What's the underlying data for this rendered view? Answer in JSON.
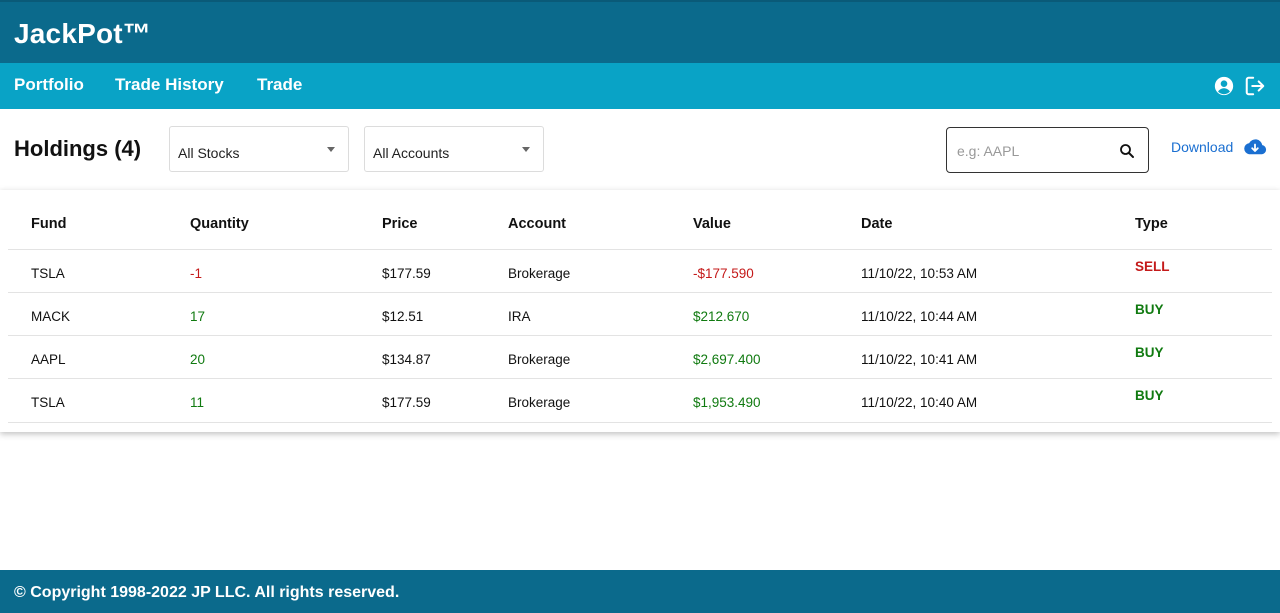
{
  "app": {
    "brand": "JackPot™"
  },
  "nav": {
    "items": [
      {
        "label": "Portfolio"
      },
      {
        "label": "Trade History"
      },
      {
        "label": "Trade"
      }
    ],
    "icons": [
      "user-circle-icon",
      "logout-icon"
    ]
  },
  "toolbar": {
    "title": "Holdings (4)",
    "stocks_filter": {
      "selected": "All Stocks"
    },
    "accounts_filter": {
      "selected": "All Accounts"
    },
    "search": {
      "placeholder": "e.g: AAPL",
      "value": ""
    },
    "download_label": "Download"
  },
  "table": {
    "headers": [
      "Fund",
      "Quantity",
      "Price",
      "Account",
      "Value",
      "Date",
      "Type"
    ],
    "rows": [
      {
        "fund": "TSLA",
        "quantity": "-1",
        "price": "$177.59",
        "account": "Brokerage",
        "value": "-$177.590",
        "date": "11/10/22, 10:53 AM",
        "type": "SELL"
      },
      {
        "fund": "MACK",
        "quantity": "17",
        "price": "$12.51",
        "account": "IRA",
        "value": "$212.670",
        "date": "11/10/22, 10:44 AM",
        "type": "BUY"
      },
      {
        "fund": "AAPL",
        "quantity": "20",
        "price": "$134.87",
        "account": "Brokerage",
        "value": "$2,697.400",
        "date": "11/10/22, 10:41 AM",
        "type": "BUY"
      },
      {
        "fund": "TSLA",
        "quantity": "11",
        "price": "$177.59",
        "account": "Brokerage",
        "value": "$1,953.490",
        "date": "11/10/22, 10:40 AM",
        "type": "BUY"
      }
    ]
  },
  "colors": {
    "topbar": "#0b6a8c",
    "navbar": "#09a3c6",
    "buy": "#107a10",
    "sell": "#c41a1a",
    "link": "#1a6fd1"
  },
  "footer": {
    "copyright": "© Copyright 1998-2022 JP LLC. All rights reserved."
  }
}
